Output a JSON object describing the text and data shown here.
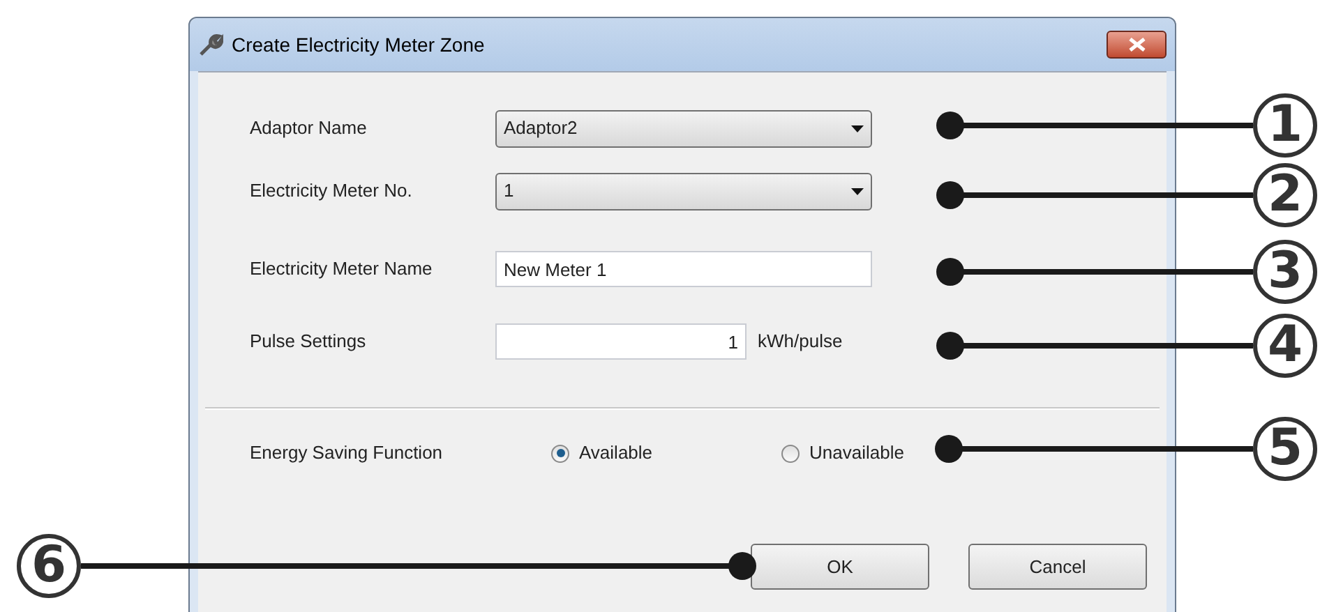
{
  "window": {
    "title": "Create Electricity Meter Zone"
  },
  "fields": [
    {
      "kind": "combo",
      "label": "Adaptor Name",
      "value": "Adaptor2"
    },
    {
      "kind": "combo",
      "label": "Electricity Meter No.",
      "value": "1"
    },
    {
      "kind": "text",
      "label": "Electricity Meter Name",
      "value": "New Meter 1"
    },
    {
      "kind": "number",
      "label": "Pulse Settings",
      "value": "1",
      "unit": "kWh/pulse"
    }
  ],
  "energy_saving": {
    "label": "Energy Saving Function",
    "options": [
      {
        "label": "Available",
        "selected": true
      },
      {
        "label": "Unavailable",
        "selected": false
      }
    ]
  },
  "buttons": [
    "OK",
    "Cancel"
  ],
  "callouts": [
    "1",
    "2",
    "3",
    "4",
    "5",
    "6"
  ]
}
